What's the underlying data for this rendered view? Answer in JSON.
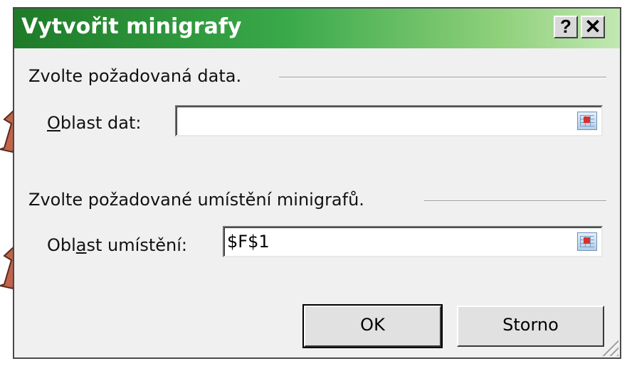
{
  "dialog": {
    "title": "Vytvořit minigrafy",
    "help_label": "?",
    "close_label": "✕",
    "data_section": {
      "heading": "Zvolte požadovaná data.",
      "field_label_mnemonic": "O",
      "field_label_rest": "blast dat:",
      "value": ""
    },
    "location_section": {
      "heading": "Zvolte požadované umístění minigrafů.",
      "field_label_before": "Obl",
      "field_label_mnemonic": "a",
      "field_label_after": "st umístění:",
      "value": "$F$1"
    },
    "ok_label": "OK",
    "cancel_label": "Storno"
  },
  "colors": {
    "title_gradient_start": "#1e7b28",
    "title_gradient_end": "#c2e8b3",
    "arrow_fill": "#c0644a"
  },
  "icons": [
    "range-picker-icon",
    "resize-grip-icon",
    "annotation-arrow"
  ]
}
